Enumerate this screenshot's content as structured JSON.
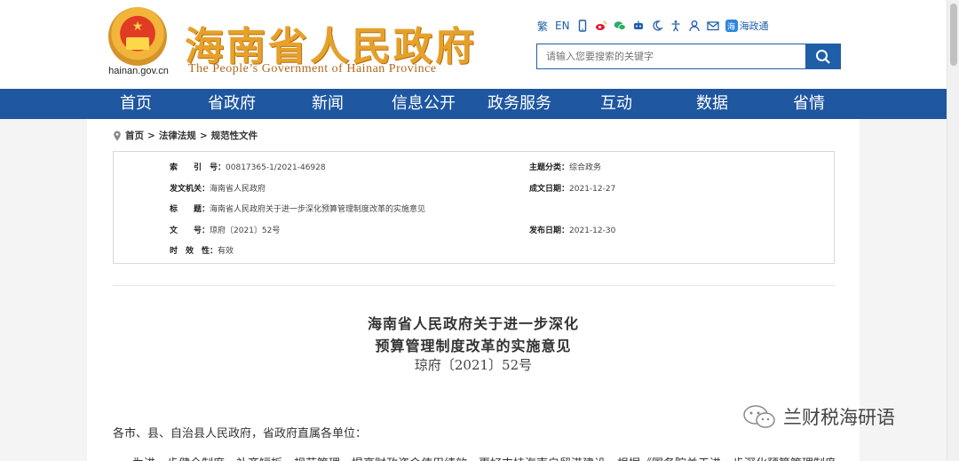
{
  "header": {
    "site_title": "海南省人民政府",
    "site_subtitle": "The People’s Government of Hainan Province",
    "site_url": "hainan.gov.cn",
    "colors": {
      "title": "#e6a12a",
      "subtitle": "#b3681a",
      "brand_blue": "#1e56a0"
    }
  },
  "toolbar": {
    "traditional": "繁",
    "english": "EN",
    "items": [
      "mobile-icon",
      "weibo-icon",
      "wechat-icon",
      "robot-icon",
      "night-mode-icon",
      "accessibility-icon",
      "user-icon",
      "mail-icon"
    ],
    "hzt_label": "海政通"
  },
  "search": {
    "placeholder": "请输入您要搜索的关键字"
  },
  "nav": {
    "items": [
      "首页",
      "省政府",
      "新闻",
      "信息公开",
      "政务服务",
      "互动",
      "数据",
      "省情"
    ]
  },
  "breadcrumb": {
    "items": [
      "首页",
      "法律法规",
      "规范性文件"
    ],
    "separator": ">"
  },
  "meta": {
    "index_key": "索　　引　号：",
    "index_val": "00817365-1/2021-46928",
    "category_key": "主题分类：",
    "category_val": "综合政务",
    "issuer_key": "发文机关：",
    "issuer_val": "海南省人民政府",
    "date_key": "成文日期：",
    "date_val": "2021-12-27",
    "title_key": "标　　题：",
    "title_val": "海南省人民政府关于进一步深化预算管理制度改革的实施意见",
    "docno_key": "文　　号：",
    "docno_val": "琼府〔2021〕52号",
    "pubdate_key": "发布日期：",
    "pubdate_val": "2021-12-30",
    "validity_key": "时　效　性：",
    "validity_val": "有效"
  },
  "document": {
    "title_line1": "海南省人民政府关于进一步深化",
    "title_line2": "预算管理制度改革的实施意见",
    "number": "琼府〔2021〕52号",
    "salutation": "各市、县、自治县人民政府，省政府直属各单位：",
    "body_first_line": "为进一步健全制度、补齐短板、规范管理、提高财政资金使用绩效，更好支持海南自贸港建设，根据《国务院关于进一步深化预算管理制度改"
  },
  "watermark": {
    "text": "兰财税海研语"
  }
}
